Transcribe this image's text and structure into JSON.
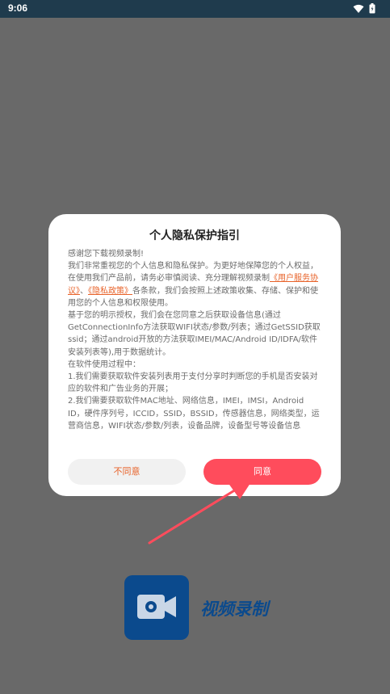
{
  "status_bar": {
    "time": "9:06"
  },
  "dialog": {
    "title": "个人隐私保护指引",
    "greeting": "感谢您下载视频录制!",
    "p1_before": "我们非常重视您的个人信息和隐私保护。为更好地保障您的个人权益，在使用我们产品前，请务必审慎阅读、充分理解视频录制",
    "link_service": "《用户服务协议》",
    "p1_separator": "、",
    "link_privacy": "《隐私政策》",
    "p1_after": "各条款，我们会按照上述政策收集、存储、保护和使用您的个人信息和权限使用。",
    "p2": "基于您的明示授权，我们会在您同意之后获取设备信息(通过GetConnectionInfo方法获取WIFI状态/参数/列表；通过GetSSID获取ssid；通过android开放的方法获取IMEI/MAC/Android ID/IDFA/软件安装列表等),用于数据统计。",
    "p3": "在软件使用过程中：",
    "p4": "1.我们需要获取软件安装列表用于支付分享时判断您的手机是否安装对应的软件和广告业务的开展；",
    "p5": "2.我们需要获取软件MAC地址、网络信息，IMEI，IMSI，Android ID，硬件序列号，ICCID，SSID，BSSID，传感器信息，网络类型，运营商信息，WIFI状态/参数/列表，设备品牌，设备型号等设备信息",
    "disagree_label": "不同意",
    "agree_label": "同意"
  },
  "app": {
    "name": "视频录制",
    "icon": "video-camera-icon"
  },
  "colors": {
    "status_bar": "#1f3b4d",
    "overlay": "#696969",
    "link": "#e8632a",
    "agree_button": "#ff4c5c",
    "arrow": "#ff4c5c",
    "app_blue": "#0b4a8d"
  }
}
